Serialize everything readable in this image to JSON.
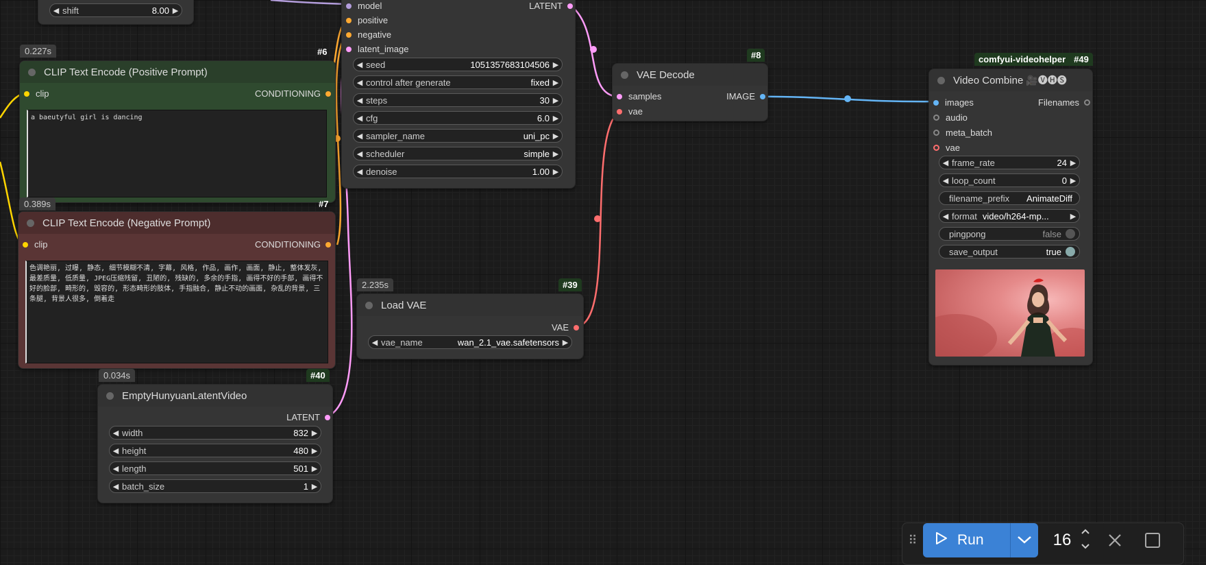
{
  "top_partial_node": {
    "widget_label": "shift",
    "widget_value": "8.00"
  },
  "ksampler": {
    "inputs": [
      "model",
      "positive",
      "negative",
      "latent_image"
    ],
    "output": "LATENT",
    "widgets": [
      {
        "label": "seed",
        "value": "1051357683104506"
      },
      {
        "label": "control after generate",
        "value": "fixed"
      },
      {
        "label": "steps",
        "value": "30"
      },
      {
        "label": "cfg",
        "value": "6.0"
      },
      {
        "label": "sampler_name",
        "value": "uni_pc"
      },
      {
        "label": "scheduler",
        "value": "simple"
      },
      {
        "label": "denoise",
        "value": "1.00"
      }
    ]
  },
  "pos_prompt": {
    "time": "0.227s",
    "id": "#6",
    "title": "CLIP Text Encode (Positive Prompt)",
    "input": "clip",
    "output": "CONDITIONING",
    "text": "a baeutyful girl is dancing"
  },
  "neg_prompt": {
    "time": "0.389s",
    "id": "#7",
    "title": "CLIP Text Encode (Negative Prompt)",
    "input": "clip",
    "output": "CONDITIONING",
    "text": "色调艳丽, 过曝, 静态, 细节模糊不清, 字幕, 风格, 作品, 画作, 画面, 静止, 整体发灰, 最差质量, 低质量, JPEG压缩残留, 丑陋的, 残缺的, 多余的手指, 画得不好的手部, 画得不好的脸部, 畸形的, 毁容的, 形态畸形的肢体, 手指融合, 静止不动的画面, 杂乱的背景, 三条腿, 背景人很多, 倒着走"
  },
  "vae_decode": {
    "id": "#8",
    "title": "VAE Decode",
    "inputs": [
      "samples",
      "vae"
    ],
    "output": "IMAGE"
  },
  "load_vae": {
    "time": "2.235s",
    "id": "#39",
    "title": "Load VAE",
    "output": "VAE",
    "widget_label": "vae_name",
    "widget_value": "wan_2.1_vae.safetensors"
  },
  "empty_latent": {
    "time": "0.034s",
    "id": "#40",
    "title": "EmptyHunyuanLatentVideo",
    "output": "LATENT",
    "widgets": [
      {
        "label": "width",
        "value": "832"
      },
      {
        "label": "height",
        "value": "480"
      },
      {
        "label": "length",
        "value": "501"
      },
      {
        "label": "batch_size",
        "value": "1"
      }
    ]
  },
  "video_combine": {
    "pack_badge": "comfyui-videohelper",
    "id": "#49",
    "title": "Video Combine",
    "title_icons": "🎥🅥🅗🅢",
    "inputs": [
      "images",
      "audio",
      "meta_batch",
      "vae"
    ],
    "output": "Filenames",
    "widgets": [
      {
        "label": "frame_rate",
        "value": "24"
      },
      {
        "label": "loop_count",
        "value": "0"
      },
      {
        "label": "filename_prefix",
        "value": "AnimateDiff"
      },
      {
        "label": "format",
        "value": "video/h264-mp..."
      }
    ],
    "toggles": [
      {
        "label": "pingpong",
        "value": "false",
        "on": false
      },
      {
        "label": "save_output",
        "value": "true",
        "on": true
      }
    ]
  },
  "toolbar": {
    "run_label": "Run",
    "batch_count": "16"
  },
  "colors": {
    "model": "#b39ddb",
    "conditioning": "#ffa931",
    "latent": "#ff9cf9",
    "clip": "#ffd500",
    "vae": "#ff6e6e",
    "image": "#64b5f6"
  }
}
